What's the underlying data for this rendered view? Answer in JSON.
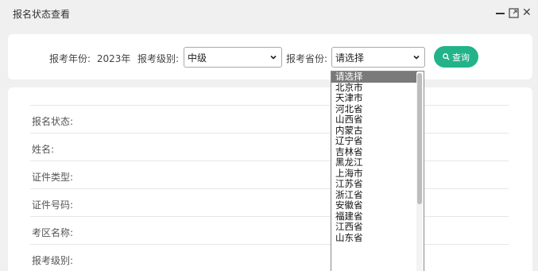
{
  "window": {
    "title": "报名状态查看",
    "controls": [
      "minimize-icon",
      "maximize-icon",
      "close-icon"
    ]
  },
  "query": {
    "year_label": "报考年份:",
    "year_value": "2023年",
    "level_label": "报考级别:",
    "level_value": "中级",
    "province_label": "报考省份:",
    "province_value": "请选择",
    "query_button": "查询"
  },
  "result": {
    "rows": [
      {
        "label": "报名状态:"
      },
      {
        "label": "姓名:"
      },
      {
        "label": "证件类型:"
      },
      {
        "label": "证件号码:"
      },
      {
        "label": "考区名称:"
      },
      {
        "label": "报考级别:"
      }
    ]
  },
  "province_dropdown": {
    "options": [
      "请选择",
      "北京市",
      "天津市",
      "河北省",
      "山西省",
      "内蒙古",
      "辽宁省",
      "吉林省",
      "黑龙江",
      "上海市",
      "江苏省",
      "浙江省",
      "安徽省",
      "福建省",
      "江西省",
      "山东省"
    ],
    "selected_index": 0
  },
  "colors": {
    "accent": "#22b38a",
    "background": "#f0f0f0",
    "card": "#ffffff",
    "selected_option": "#7a7a7a"
  }
}
